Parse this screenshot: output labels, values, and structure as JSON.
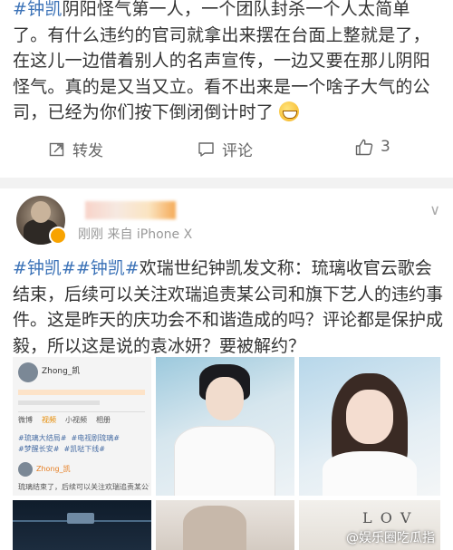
{
  "post1": {
    "tag": "#钟凯",
    "text": "阴阳怪气第一人，一个团队封杀一个人太简单了。有什么违约的官司就拿出来摆在台面上整就是了，在这儿一边借着别人的名声宣传，一边又要在那儿阴阳怪气。真的是又当又立。看不出来是一个啥子大气的公司，已经为你们按下倒闭倒计时了",
    "repost_label": "转发",
    "comment_label": "评论",
    "like_count": "3"
  },
  "post2": {
    "meta": "刚刚  来自 iPhone X",
    "tag1": "#钟凯#",
    "tag2": "#钟凯#",
    "text": "欢瑞世纪钟凯发文称：琉璃收官云歌会结束，后续可以关注欢瑞追责某公司和旗下艺人的违约事件。这是昨天的庆功会不和谐造成的吗？评论都是保护成毅，所以这是说的袁冰妍？要被解约？",
    "thumb1": {
      "name": "Zhong_凯",
      "tabs": [
        "微博",
        "视频",
        "小视频",
        "相册"
      ],
      "tags": [
        "#琉璃大结局#",
        "#电视剧琉璃#",
        "#梦醒长安#",
        "#凯哒下线#"
      ],
      "post_name": "Zhong_凯",
      "post_text": "琉璃结束了，后续可以关注欢瑞追责某公司和旗下艺人"
    },
    "thumb6_text": "L O V",
    "watermark": "@娱乐圈吃瓜指"
  }
}
